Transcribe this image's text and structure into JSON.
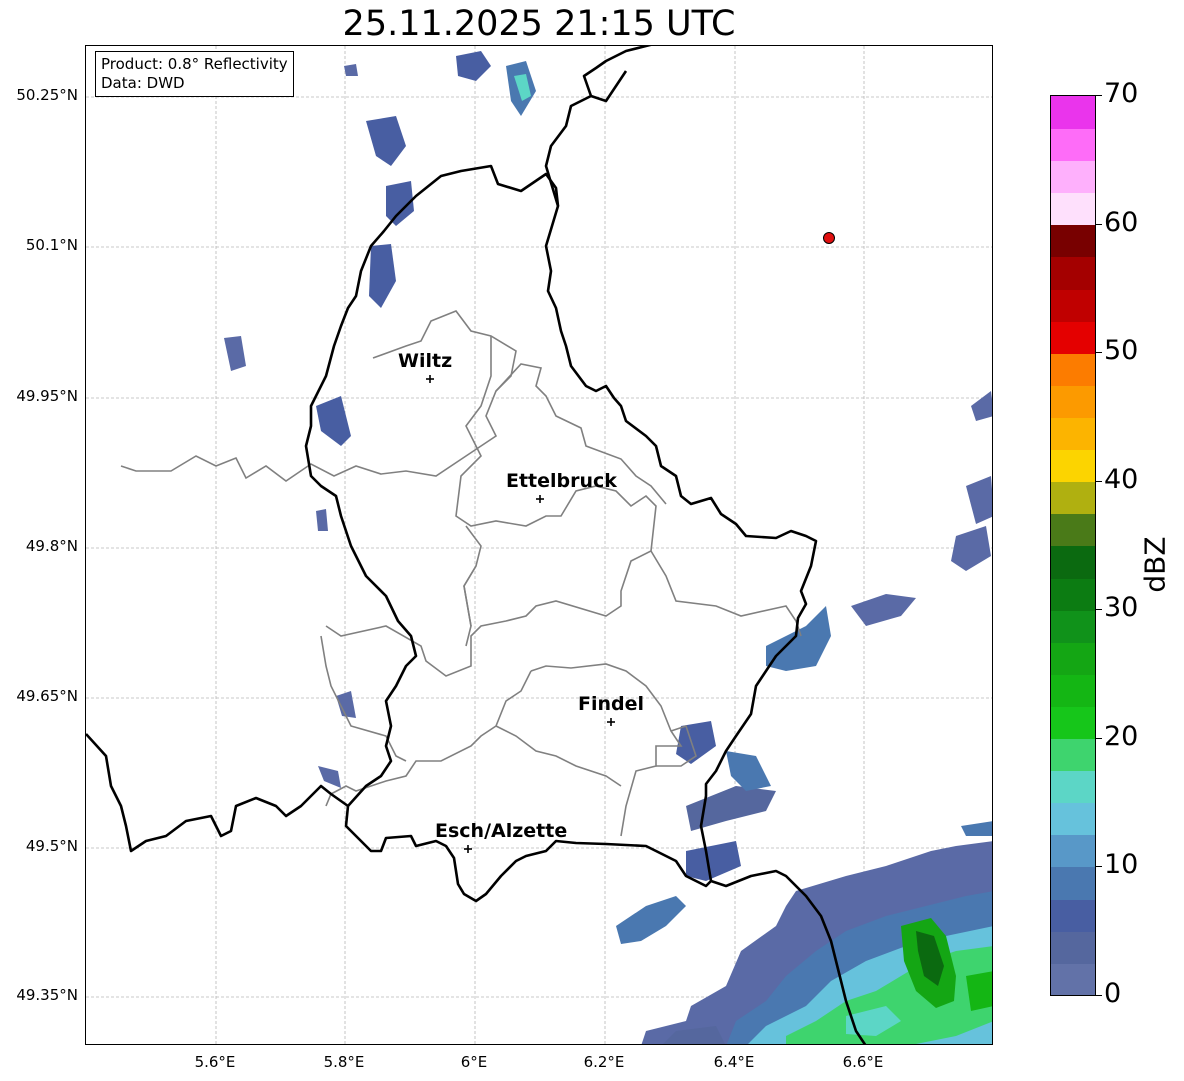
{
  "title": "25.11.2025 21:15 UTC",
  "info": {
    "product": "Product: 0.8° Reflectivity",
    "data": "Data: DWD"
  },
  "y_ticks": [
    "50.25°N",
    "50.1°N",
    "49.95°N",
    "49.8°N",
    "49.65°N",
    "49.5°N",
    "49.35°N"
  ],
  "x_ticks": [
    "5.6°E",
    "5.8°E",
    "6°E",
    "6.2°E",
    "6.4°E",
    "6.6°E"
  ],
  "cities": [
    {
      "name": "Wiltz"
    },
    {
      "name": "Ettelbruck"
    },
    {
      "name": "Findel"
    },
    {
      "name": "Esch/Alzette"
    }
  ],
  "colorbar": {
    "label": "dBZ",
    "ticks": [
      "0",
      "10",
      "20",
      "30",
      "40",
      "50",
      "60",
      "70"
    ],
    "colors": [
      "#6272a8",
      "#55679e",
      "#485ea2",
      "#4a78b0",
      "#5898c8",
      "#66c2dc",
      "#5cd6c6",
      "#3ed46e",
      "#16c61a",
      "#14b614",
      "#14a614",
      "#10921a",
      "#0c7c12",
      "#0b6a10",
      "#4a7a18",
      "#b0b010",
      "#fcd400",
      "#fcb400",
      "#fc9a00",
      "#fc7c00",
      "#e40000",
      "#c00000",
      "#a40000",
      "#780000",
      "#fee0fc",
      "#feb0fc",
      "#fe6cf8",
      "#ea34ec"
    ]
  },
  "radar_site": {
    "color": "#e01010"
  }
}
